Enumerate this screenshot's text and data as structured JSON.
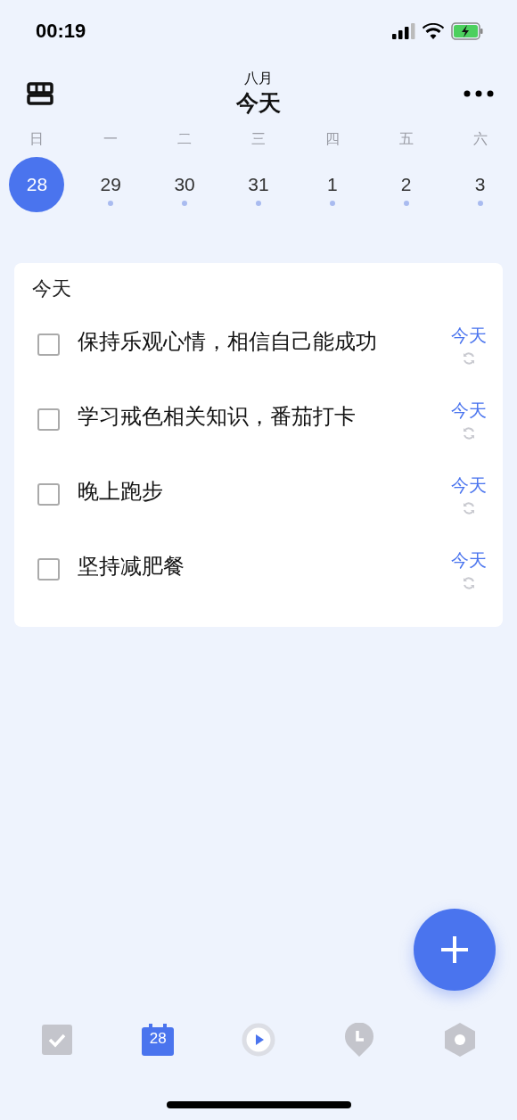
{
  "status_bar": {
    "time": "00:19"
  },
  "header": {
    "month": "八月",
    "title": "今天"
  },
  "week": [
    {
      "weekday": "日",
      "date": "28",
      "selected": true,
      "dot": false
    },
    {
      "weekday": "一",
      "date": "29",
      "selected": false,
      "dot": true
    },
    {
      "weekday": "二",
      "date": "30",
      "selected": false,
      "dot": true
    },
    {
      "weekday": "三",
      "date": "31",
      "selected": false,
      "dot": true
    },
    {
      "weekday": "四",
      "date": "1",
      "selected": false,
      "dot": true
    },
    {
      "weekday": "五",
      "date": "2",
      "selected": false,
      "dot": true
    },
    {
      "weekday": "六",
      "date": "3",
      "selected": false,
      "dot": true
    }
  ],
  "section": {
    "title": "今天",
    "tasks": [
      {
        "title": "保持乐观心情，相信自己能成功",
        "due": "今天",
        "checked": false,
        "repeat": true
      },
      {
        "title": "学习戒色相关知识，番茄打卡",
        "due": "今天",
        "checked": false,
        "repeat": true
      },
      {
        "title": "晚上跑步",
        "due": "今天",
        "checked": false,
        "repeat": true
      },
      {
        "title": "坚持减肥餐",
        "due": "今天",
        "checked": false,
        "repeat": true
      }
    ]
  },
  "tab_bar": [
    {
      "kind": "tasks",
      "selected": false
    },
    {
      "kind": "calendar",
      "label": "28",
      "selected": true
    },
    {
      "kind": "focus",
      "selected": false
    },
    {
      "kind": "habits",
      "selected": false
    },
    {
      "kind": "settings",
      "selected": false
    }
  ]
}
